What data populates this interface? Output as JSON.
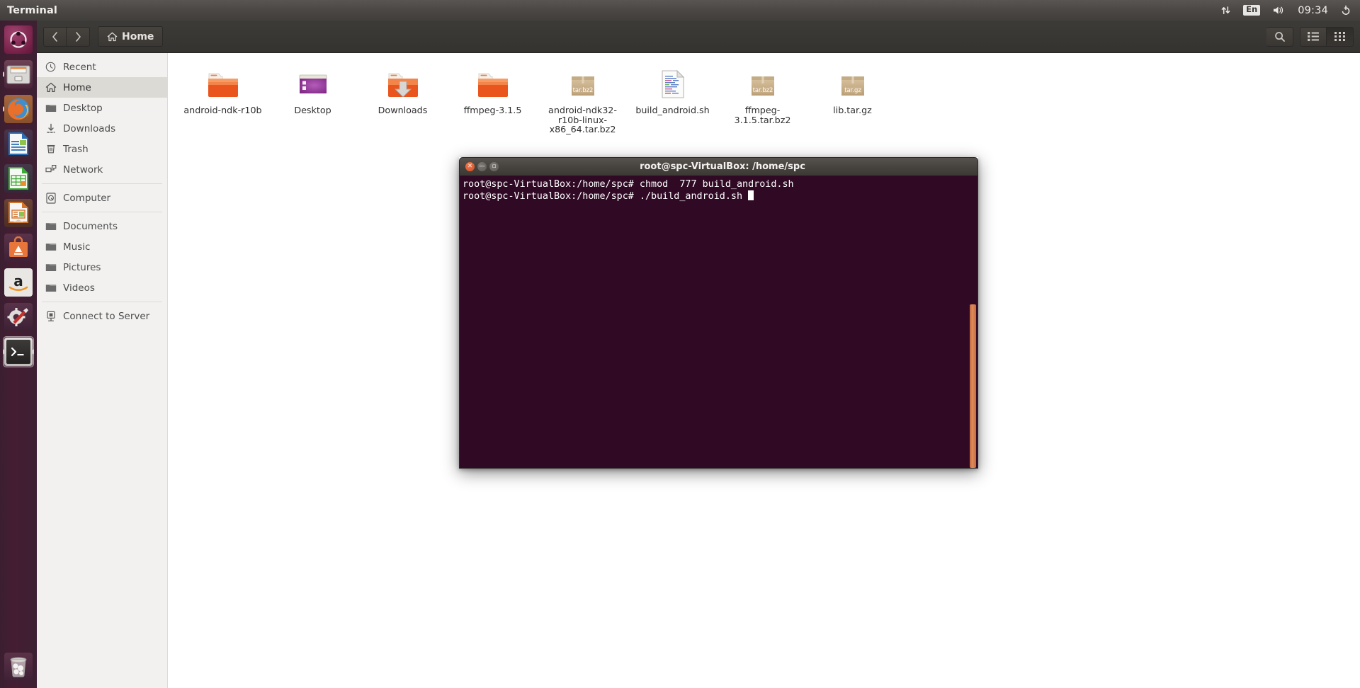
{
  "panel": {
    "app_title": "Terminal",
    "tray": {
      "network_icon": "network-updown-icon",
      "keyboard_label": "En",
      "volume_icon": "volume-icon",
      "clock": "09:34",
      "power_icon": "power-gear-icon"
    }
  },
  "launcher": {
    "items": [
      {
        "name": "ubuntu-dash",
        "label": "Ubuntu Dash"
      },
      {
        "name": "files",
        "label": "Files"
      },
      {
        "name": "firefox",
        "label": "Firefox Web Browser"
      },
      {
        "name": "libreoffice-writer",
        "label": "LibreOffice Writer"
      },
      {
        "name": "libreoffice-calc",
        "label": "LibreOffice Calc"
      },
      {
        "name": "libreoffice-impress",
        "label": "LibreOffice Impress"
      },
      {
        "name": "ubuntu-software",
        "label": "Ubuntu Software Center"
      },
      {
        "name": "amazon",
        "label": "Amazon"
      },
      {
        "name": "system-settings",
        "label": "System Settings"
      },
      {
        "name": "terminal",
        "label": "Terminal"
      }
    ],
    "trash": {
      "name": "trash",
      "label": "Trash"
    }
  },
  "file_manager": {
    "toolbar": {
      "back_icon": "chevron-left-icon",
      "forward_icon": "chevron-right-icon",
      "breadcrumb_label": "Home",
      "breadcrumb_icon": "home-icon",
      "search_icon": "search-icon",
      "list_view_icon": "list-view-icon",
      "grid_view_icon": "grid-view-icon",
      "active_view": "grid"
    },
    "sidebar": {
      "groups": [
        {
          "items": [
            {
              "label": "Recent",
              "icon": "clock-icon",
              "selected": false
            },
            {
              "label": "Home",
              "icon": "home-icon",
              "selected": true
            },
            {
              "label": "Desktop",
              "icon": "folder-icon",
              "selected": false
            },
            {
              "label": "Downloads",
              "icon": "download-icon",
              "selected": false
            },
            {
              "label": "Trash",
              "icon": "trash-icon",
              "selected": false
            },
            {
              "label": "Network",
              "icon": "network-icon",
              "selected": false
            }
          ]
        },
        {
          "items": [
            {
              "label": "Computer",
              "icon": "computer-disk-icon",
              "selected": false
            }
          ]
        },
        {
          "items": [
            {
              "label": "Documents",
              "icon": "folder-icon",
              "selected": false
            },
            {
              "label": "Music",
              "icon": "folder-icon",
              "selected": false
            },
            {
              "label": "Pictures",
              "icon": "folder-icon",
              "selected": false
            },
            {
              "label": "Videos",
              "icon": "folder-icon",
              "selected": false
            }
          ]
        },
        {
          "items": [
            {
              "label": "Connect to Server",
              "icon": "server-icon",
              "selected": false
            }
          ]
        }
      ]
    },
    "files": [
      {
        "label": "android-ndk-r10b",
        "icon": "folder-icon",
        "badge": ""
      },
      {
        "label": "Desktop",
        "icon": "desktop-folder-icon",
        "badge": ""
      },
      {
        "label": "Downloads",
        "icon": "downloads-folder-icon",
        "badge": ""
      },
      {
        "label": "ffmpeg-3.1.5",
        "icon": "folder-icon",
        "badge": ""
      },
      {
        "label": "android-ndk32-r10b-linux-x86_64.tar.bz2",
        "icon": "archive-icon",
        "badge": "tar.bz2"
      },
      {
        "label": "build_android.sh",
        "icon": "script-file-icon",
        "badge": ""
      },
      {
        "label": "ffmpeg-3.1.5.tar.bz2",
        "icon": "archive-icon",
        "badge": "tar.bz2"
      },
      {
        "label": "lib.tar.gz",
        "icon": "archive-icon",
        "badge": "tar.gz"
      }
    ]
  },
  "terminal": {
    "title": "root@spc-VirtualBox: /home/spc",
    "close_icon": "close-icon",
    "minimize_icon": "minimize-icon",
    "maximize_icon": "maximize-icon",
    "lines": [
      "root@spc-VirtualBox:/home/spc# chmod  777 build_android.sh",
      "root@spc-VirtualBox:/home/spc# ./build_android.sh "
    ],
    "background_color": "#300a24",
    "scrollbar_color": "#d4793f"
  }
}
